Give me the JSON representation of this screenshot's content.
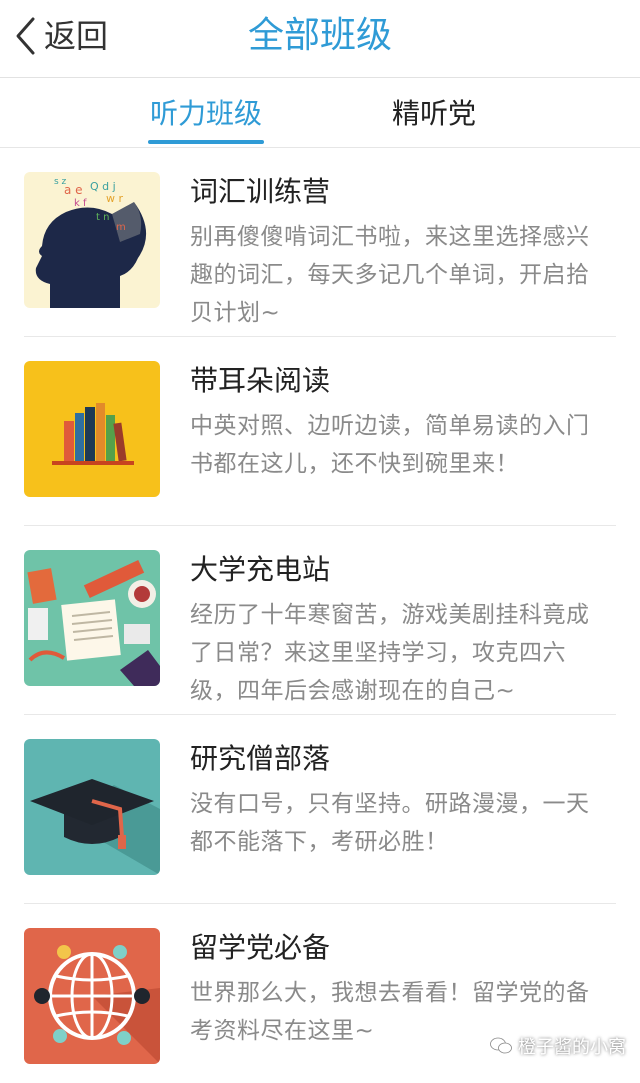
{
  "header": {
    "back_label": "返回",
    "title": "全部班级"
  },
  "tabs": [
    {
      "label": "听力班级",
      "active": true
    },
    {
      "label": "精听党",
      "active": false
    }
  ],
  "classes": [
    {
      "title": "词汇训练营",
      "description": "别再傻傻啃词汇书啦，来这里选择感兴趣的词汇，每天多记几个单词，开启拾贝计划~",
      "icon": "head-letters-icon"
    },
    {
      "title": "带耳朵阅读",
      "description": "中英对照、边听边读，简单易读的入门书都在这儿，还不快到碗里来！",
      "icon": "bookshelf-icon"
    },
    {
      "title": "大学充电站",
      "description": "经历了十年寒窗苦，游戏美剧挂科竟成了日常？来这里坚持学习，攻克四六级，四年后会感谢现在的自己~",
      "icon": "study-desk-icon"
    },
    {
      "title": "研究僧部落",
      "description": "没有口号，只有坚持。研路漫漫，一天都不能落下，考研必胜！",
      "icon": "graduation-cap-icon"
    },
    {
      "title": "留学党必备",
      "description": "世界那么大，我想去看看！留学党的备考资料尽在这里~",
      "icon": "globe-network-icon"
    }
  ],
  "watermark": "橙子酱的小窝",
  "colors": {
    "accent": "#2f9bd6"
  }
}
